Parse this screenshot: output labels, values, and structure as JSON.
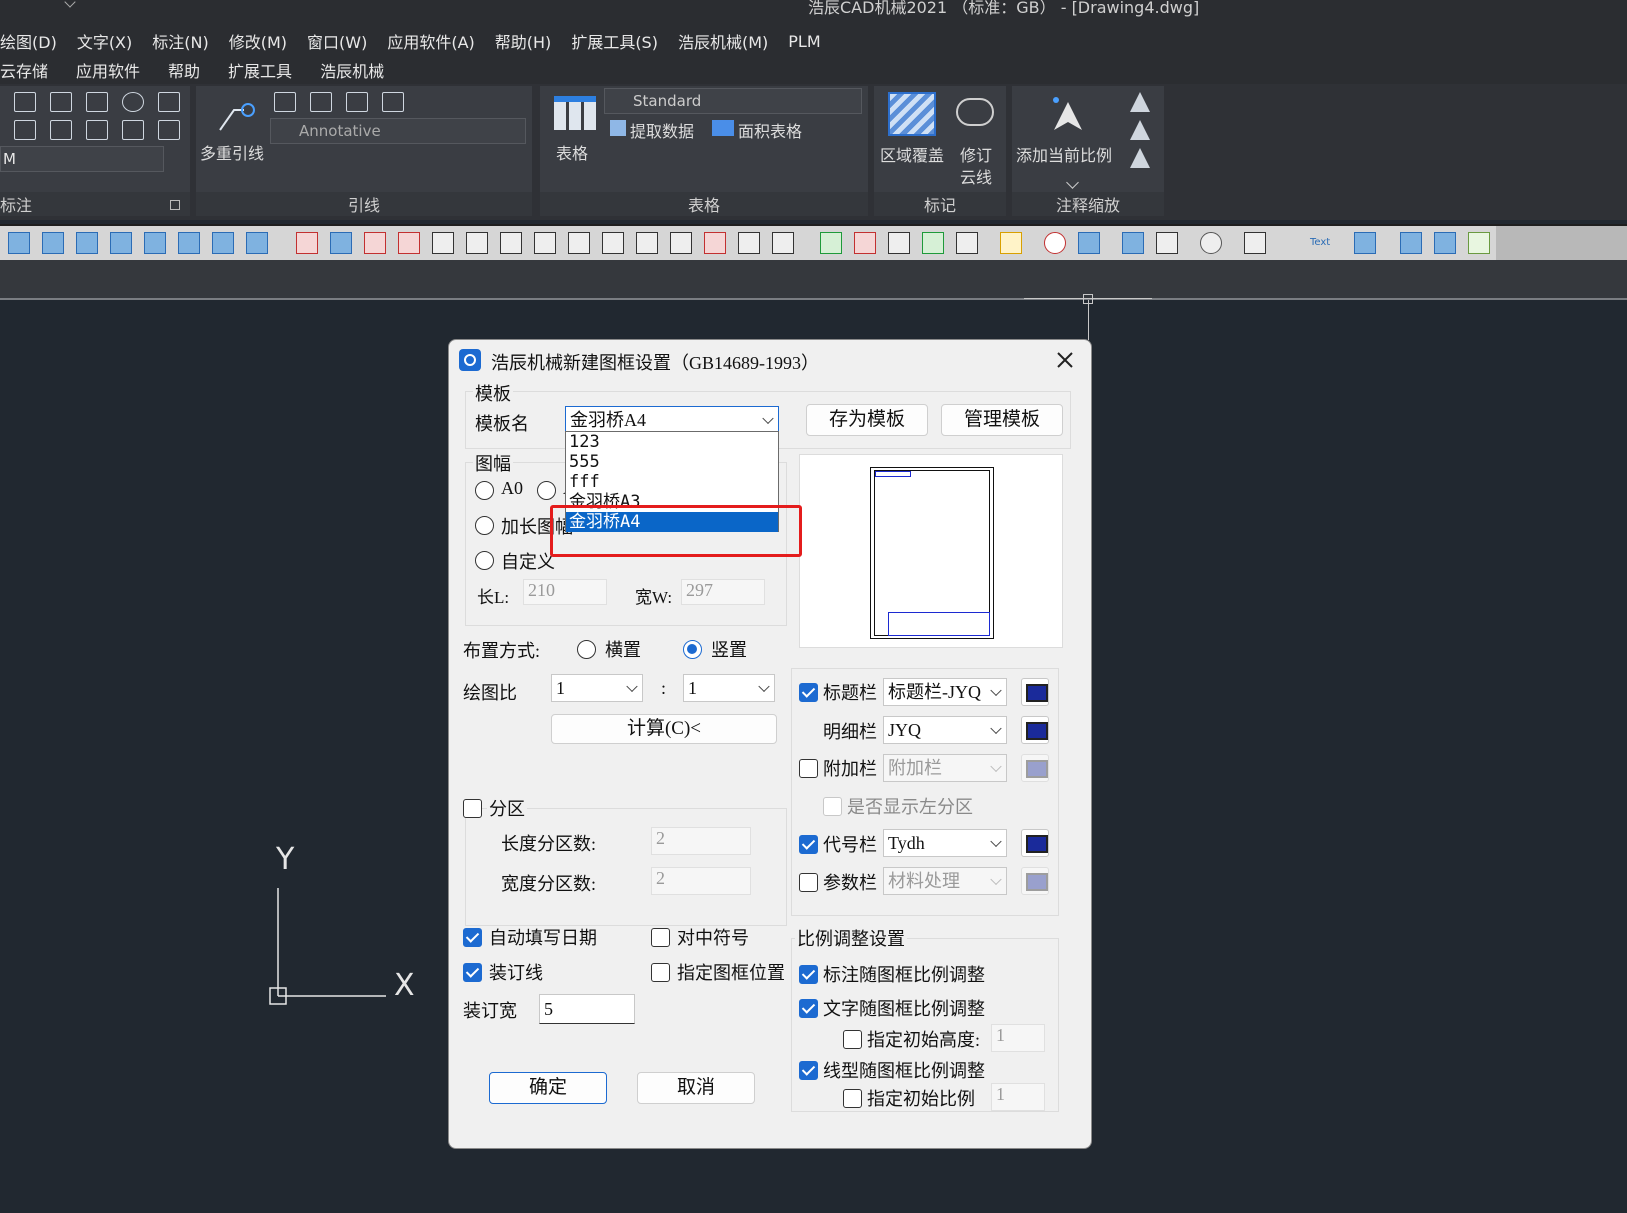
{
  "app": {
    "title": "浩辰CAD机械2021 （标准：GB） - [Drawing4.dwg]",
    "menu": [
      "绘图(D)",
      "文字(X)",
      "标注(N)",
      "修改(M)",
      "窗口(W)",
      "应用软件(A)",
      "帮助(H)",
      "扩展工具(S)",
      "浩辰机械(M)",
      "PLM"
    ],
    "tabs": [
      "云存储",
      "应用软件",
      "帮助",
      "扩展工具",
      "浩辰机械"
    ]
  },
  "ribbon": {
    "dim_panel": {
      "label": "标注",
      "combo_value": "M"
    },
    "leader_panel": {
      "label": "引线",
      "button": "多重引线",
      "style": "Annotative"
    },
    "table_panel": {
      "label": "表格",
      "button": "表格",
      "style": "Standard",
      "extract": "提取数据",
      "area_table": "面积表格"
    },
    "mark_panel": {
      "label": "标记",
      "wipeout": "区域覆盖",
      "revcloud_line1": "修订",
      "revcloud_line2": "云线"
    },
    "scale_panel": {
      "label": "注释缩放",
      "add_scale": "添加当前比例"
    }
  },
  "toolbar": {
    "text_icon": "Text"
  },
  "dialog": {
    "title": "浩辰机械新建图框设置（GB14689-1993）",
    "template_group": "模板",
    "template_label": "模板名",
    "template_value": "金羽桥A4",
    "template_options": [
      "123",
      "555",
      "fff",
      "金羽桥A3",
      "金羽桥A4"
    ],
    "save_template": "存为模板",
    "manage_template": "管理模板",
    "size_group": "图幅",
    "size_a0": "A0",
    "size_a1_partial": "A",
    "size_long": "加长图幅",
    "size_custom": "自定义",
    "length_label": "长L:",
    "length_value": "210",
    "width_label": "宽W:",
    "width_value": "297",
    "layout_label": "布置方式:",
    "layout_horizontal": "横置",
    "layout_vertical": "竖置",
    "scale_label": "绘图比",
    "scale_left": "1",
    "scale_sep": ":",
    "scale_right": "1",
    "calc_button": "计算(C)<",
    "zone_label": "分区",
    "zone_length_label": "长度分区数:",
    "zone_length_value": "2",
    "zone_width_label": "宽度分区数:",
    "zone_width_value": "2",
    "auto_date": "自动填写日期",
    "center_mark": "对中符号",
    "binding_line": "装订线",
    "frame_position": "指定图框位置",
    "binding_width_label": "装订宽",
    "binding_width_value": "5",
    "ok": "确定",
    "cancel": "取消",
    "title_block_label": "标题栏",
    "title_block_value": "标题栏-JYQ",
    "detail_label": "明细栏",
    "detail_value": "JYQ",
    "extra_label": "附加栏",
    "extra_value": "附加栏",
    "show_left_zone": "是否显示左分区",
    "code_label": "代号栏",
    "code_value": "Tydh",
    "param_label": "参数栏",
    "param_value": "材料处理",
    "scale_group": "比例调整设置",
    "dim_follow": "标注随图框比例调整",
    "text_follow": "文字随图框比例调整",
    "init_height": "指定初始高度:",
    "init_height_value": "1",
    "linetype_follow": "线型随图框比例调整",
    "init_scale": "指定初始比例",
    "init_scale_value": "1"
  },
  "canvas": {
    "ucs_y": "Y",
    "ucs_x": "X"
  }
}
